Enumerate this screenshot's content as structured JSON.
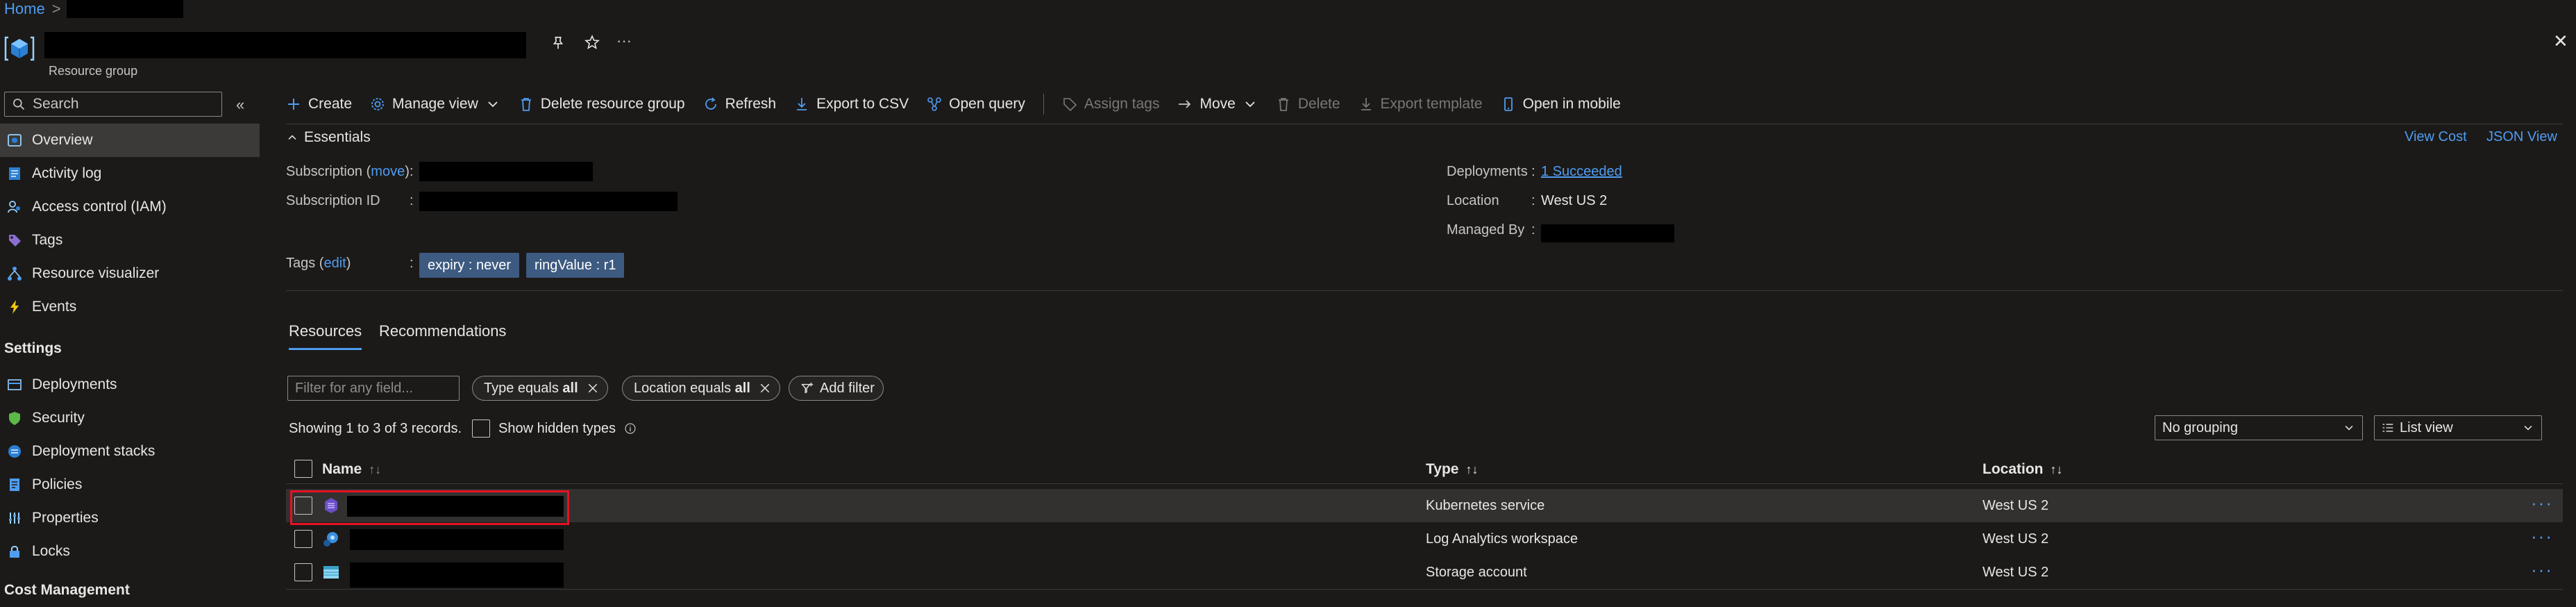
{
  "breadcrumb": {
    "home": "Home",
    "separator": ">"
  },
  "header": {
    "resource_type": "Resource group",
    "close_label": "✕"
  },
  "sidebar": {
    "search_placeholder": "Search",
    "collapse_label": "«",
    "items": [
      {
        "label": "Overview",
        "icon": "overview-icon",
        "active": true
      },
      {
        "label": "Activity log",
        "icon": "activity-log-icon"
      },
      {
        "label": "Access control (IAM)",
        "icon": "iam-icon"
      },
      {
        "label": "Tags",
        "icon": "tag-icon"
      },
      {
        "label": "Resource visualizer",
        "icon": "visualizer-icon"
      },
      {
        "label": "Events",
        "icon": "lightning-icon"
      }
    ],
    "settings_title": "Settings",
    "settings_items": [
      {
        "label": "Deployments",
        "icon": "deployments-icon"
      },
      {
        "label": "Security",
        "icon": "shield-icon"
      },
      {
        "label": "Deployment stacks",
        "icon": "stacks-icon"
      },
      {
        "label": "Policies",
        "icon": "policies-icon"
      },
      {
        "label": "Properties",
        "icon": "properties-icon"
      },
      {
        "label": "Locks",
        "icon": "lock-icon"
      }
    ],
    "cost_title": "Cost Management"
  },
  "toolbar": {
    "create": "Create",
    "manage_view": "Manage view",
    "delete_rg": "Delete resource group",
    "refresh": "Refresh",
    "export_csv": "Export to CSV",
    "open_query": "Open query",
    "assign_tags": "Assign tags",
    "move": "Move",
    "delete": "Delete",
    "export_template": "Export template",
    "open_mobile": "Open in mobile"
  },
  "essentials": {
    "title": "Essentials",
    "view_cost": "View Cost",
    "json_view": "JSON View",
    "subscription_label": "Subscription",
    "move_link": "move",
    "subscription_id_label": "Subscription ID",
    "tags_label": "Tags",
    "edit_link": "edit",
    "colon": ":",
    "tags": [
      "expiry : never",
      "ringValue : r1"
    ],
    "deployments_label": "Deployments",
    "deployments_value": "1 Succeeded",
    "location_label": "Location",
    "location_value": "West US 2",
    "managed_by_label": "Managed By"
  },
  "tabs": {
    "resources": "Resources",
    "recommendations": "Recommendations"
  },
  "filters": {
    "placeholder": "Filter for any field...",
    "type_filter_prefix": "Type equals",
    "type_filter_value": "all",
    "location_filter_prefix": "Location equals",
    "location_filter_value": "all",
    "add_filter": "Add filter"
  },
  "records": {
    "showing": "Showing 1 to 3 of 3 records.",
    "show_hidden": "Show hidden types",
    "grouping": "No grouping",
    "view": "List view"
  },
  "table": {
    "headers": {
      "name": "Name",
      "type": "Type",
      "location": "Location"
    },
    "rows": [
      {
        "type": "Kubernetes service",
        "location": "West US 2",
        "icon": "kubernetes-icon"
      },
      {
        "type": "Log Analytics workspace",
        "location": "West US 2",
        "icon": "log-analytics-icon"
      },
      {
        "type": "Storage account",
        "location": "West US 2",
        "icon": "storage-icon"
      }
    ]
  },
  "colors": {
    "accent": "#4f9cf0",
    "tag_bg": "#3d5a80",
    "highlight_border": "#e81123"
  }
}
